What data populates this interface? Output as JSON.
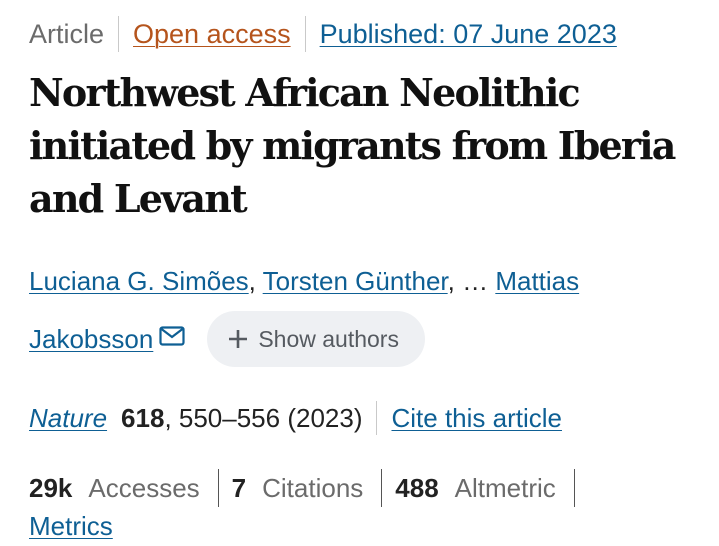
{
  "meta": {
    "article_type": "Article",
    "access": "Open access",
    "published": "Published: 07 June 2023"
  },
  "title": "Northwest African Neolithic initiated by migrants from Iberia and Levant",
  "authors": {
    "author1": "Luciana G. Simões",
    "comma1": ", ",
    "author2": "Torsten Günther",
    "ellipsis": ", … ",
    "author3_part1": "Mattias",
    "author3_part2": "Jakobsson",
    "mail_icon": "envelope-icon",
    "show_authors_label": "Show authors",
    "show_authors_icon": "plus-icon"
  },
  "citation": {
    "journal": "Nature",
    "volume": "618",
    "pages_year": ", 550–556 (2023)",
    "cite_link": "Cite this article"
  },
  "metrics": {
    "accesses_count": "29k",
    "accesses_label": "Accesses",
    "citations_count": "7",
    "citations_label": "Citations",
    "altmetric_count": "488",
    "altmetric_label": "Altmetric",
    "metrics_link": "Metrics"
  },
  "colors": {
    "link_blue": "#0e5f94",
    "open_access_orange": "#b5541c",
    "button_bg": "#eef0f3"
  }
}
